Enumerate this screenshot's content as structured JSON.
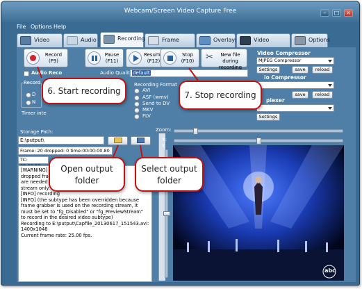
{
  "window": {
    "title": "Webcam/Screen Video Capture Free"
  },
  "menu": [
    "File",
    "Options",
    "Help"
  ],
  "tabs": [
    {
      "label": "Video Source",
      "icon": "film-icon"
    },
    {
      "label": "Audio",
      "icon": "speaker-icon"
    },
    {
      "label": "Recording",
      "icon": "record-icon",
      "active": true
    },
    {
      "label": "Frame Grabber",
      "icon": "camera-icon"
    },
    {
      "label": "Overlays",
      "icon": "layers-icon"
    },
    {
      "label": "Video Processing",
      "icon": "wand-icon"
    },
    {
      "label": "Options",
      "icon": "tools-icon"
    }
  ],
  "toolbar": {
    "record": {
      "label": "Record",
      "key": "(F9)"
    },
    "pause": {
      "label": "Pause",
      "key": "(F11)"
    },
    "resume": {
      "label": "Resume",
      "key": "(F12)"
    },
    "stop": {
      "label": "Stop",
      "key": "(F10)"
    },
    "newfile": {
      "label": "New file during",
      "label2": "recording"
    }
  },
  "audio": {
    "record_label": "Audio Reco",
    "quality_label": "Audio Quality:",
    "quality_value": "default"
  },
  "recording": {
    "format_label": "Recording Format",
    "formats": [
      "AVI",
      "ASF (wmv)",
      "Send to DV",
      "MKV",
      "FLV"
    ],
    "left_group_label": "Record",
    "left_options": [
      "D",
      "N"
    ],
    "timer_label": "Timer inte"
  },
  "compressor": {
    "video_label": "Video Compressor",
    "video_value": "MJPEG Compressor",
    "audio_label": "io Compressor",
    "mux_label": "plexer",
    "settings": "Settings",
    "save": "save",
    "reload": "reload"
  },
  "storage": {
    "label": "Storage Path:",
    "path": "E:\\putput\\",
    "frames": "Frame: 20 dropped: 0 time:00:00:00.80",
    "tc": "TC: 00:00:00:"
  },
  "log": [
    "[WARNING] T",
    "dropped fram",
    "are needed in",
    "stream only.",
    "[INFO] recording",
    "[INFO] (the subtype has been overridden because frame grabber is used on the recording stream, it must be set to \"fg_Disabled\" or \"fg_PreviewStream\" to record in the desired video subtype)",
    "Recording to E:\\putput\\Capfile_20130617_151543.avi: 1400x1048",
    "Current frame rate: 25.00 fps."
  ],
  "zoom": {
    "zoom_label": "Zoom:",
    "x_label": "X:",
    "y_label": "Y:"
  },
  "video": {
    "watermark": "abc"
  },
  "annotations": {
    "start": "6. Start recording",
    "stop": "7. Stop recording",
    "open1": "Open output",
    "open2": "folder",
    "select1": "Select output",
    "select2": "folder"
  },
  "colors": {
    "accent": "#c01414",
    "window": "#3a6b93"
  }
}
